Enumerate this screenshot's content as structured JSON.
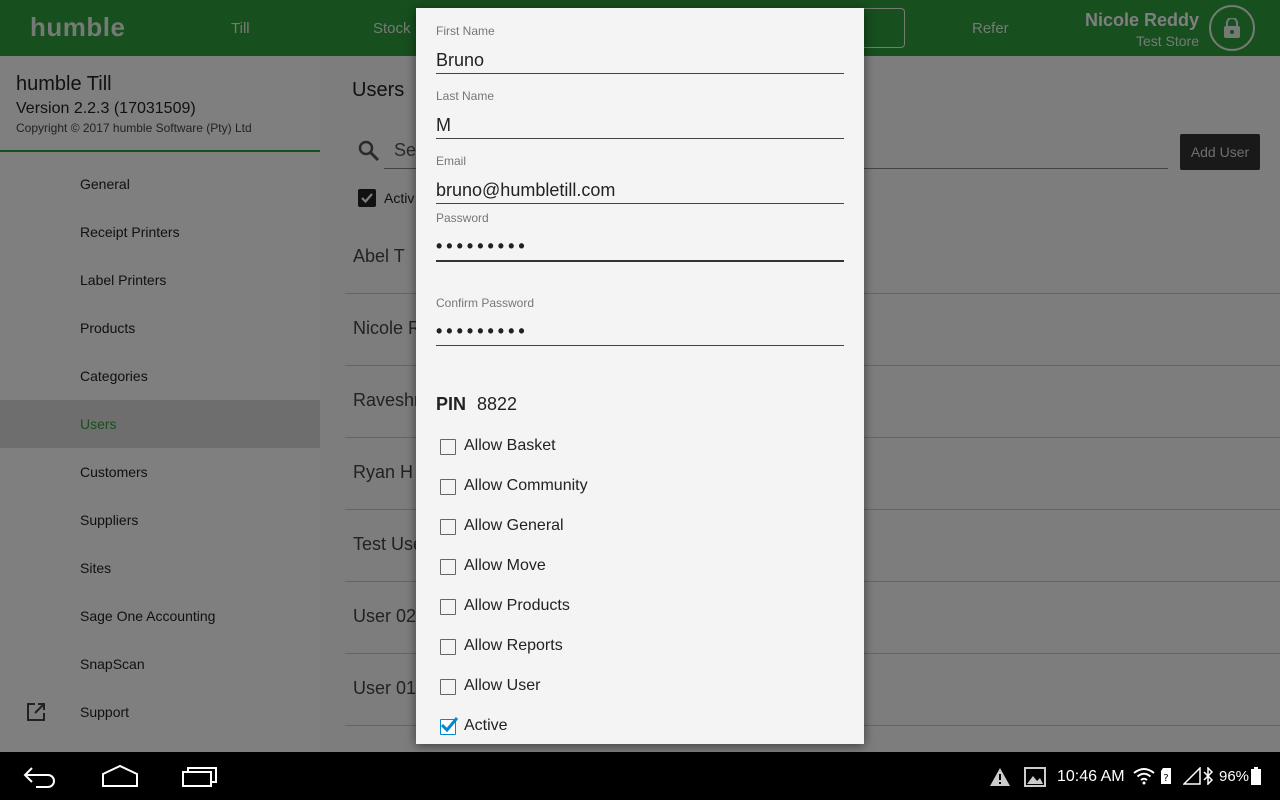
{
  "topbar": {
    "brand": "humble",
    "nav": [
      "Till",
      "Stock",
      "Refer"
    ],
    "user_name": "Nicole Reddy",
    "store_name": "Test Store",
    "lock_icon": "lock-icon"
  },
  "sidebar": {
    "app_title": "humble Till",
    "version": "Version 2.2.3 (17031509)",
    "copyright": "Copyright © 2017 humble Software (Pty) Ltd",
    "items": [
      {
        "label": "General"
      },
      {
        "label": "Receipt Printers"
      },
      {
        "label": "Label Printers"
      },
      {
        "label": "Products"
      },
      {
        "label": "Categories"
      },
      {
        "label": "Users",
        "active": true
      },
      {
        "label": "Customers"
      },
      {
        "label": "Suppliers"
      },
      {
        "label": "Sites"
      },
      {
        "label": "Sage One Accounting"
      },
      {
        "label": "SnapScan"
      },
      {
        "label": "Support",
        "icon": "external-link-icon"
      }
    ]
  },
  "main": {
    "title": "Users",
    "search_placeholder": "Sea",
    "add_user_label": "Add User",
    "active_filter_label": "Activ",
    "users": [
      "Abel T",
      "Nicole R",
      "Raveshn",
      "Ryan H",
      "Test Use",
      "User 02",
      "User  01"
    ]
  },
  "dialog": {
    "first_name_label": "First Name",
    "first_name_value": "Bruno",
    "last_name_label": "Last Name",
    "last_name_value": "M",
    "email_label": "Email",
    "email_value": "bruno@humbletill.com",
    "password_label": "Password",
    "password_value": "•••••••••",
    "confirm_password_label": "Confirm Password",
    "confirm_password_value": "•••••••••",
    "pin_label": "PIN",
    "pin_value": "8822",
    "permissions": [
      {
        "label": "Allow Basket",
        "checked": false
      },
      {
        "label": "Allow Community",
        "checked": false
      },
      {
        "label": "Allow General",
        "checked": false
      },
      {
        "label": "Allow Move",
        "checked": false
      },
      {
        "label": "Allow Products",
        "checked": false
      },
      {
        "label": "Allow Reports",
        "checked": false
      },
      {
        "label": "Allow User",
        "checked": false
      },
      {
        "label": "Active",
        "checked": true
      }
    ]
  },
  "system_bar": {
    "time": "10:46 AM",
    "battery": "96%"
  },
  "colors": {
    "brand_green": "#2e9e3c",
    "checkbox_accent": "#0288d1"
  }
}
